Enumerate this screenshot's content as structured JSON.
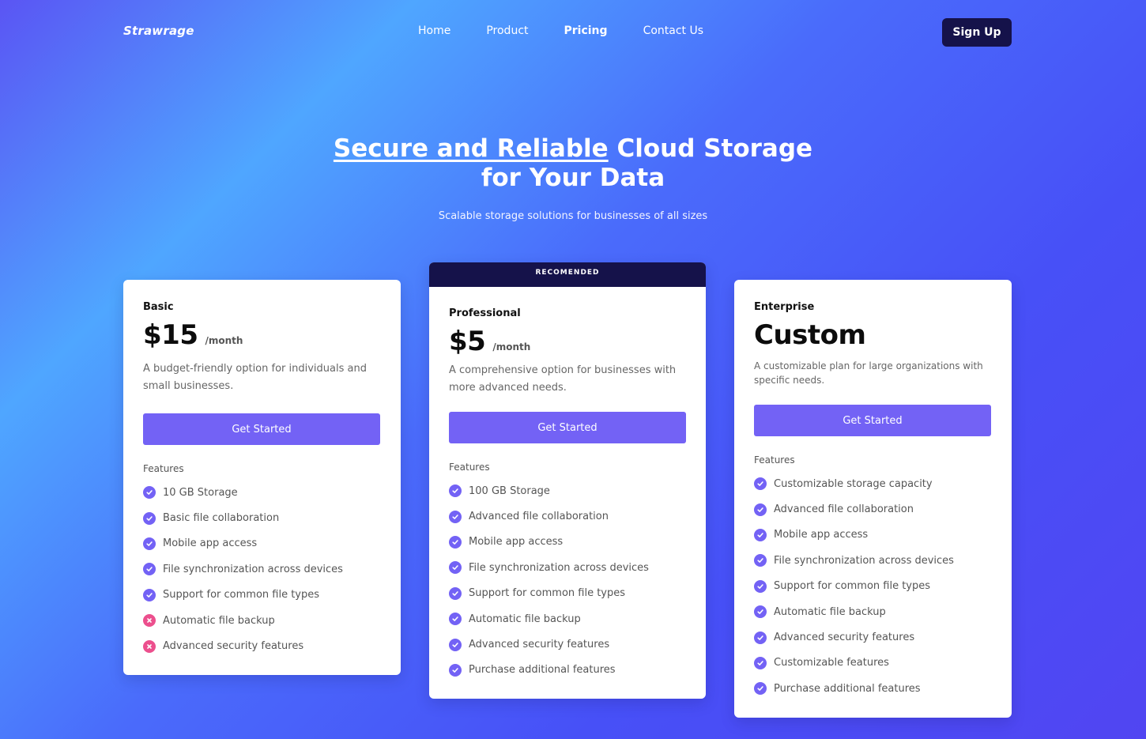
{
  "nav": {
    "brand": "Strawrage",
    "links": [
      {
        "label": "Home",
        "active": false
      },
      {
        "label": "Product",
        "active": false
      },
      {
        "label": "Pricing",
        "active": true
      },
      {
        "label": "Contact Us",
        "active": false
      }
    ],
    "signup_label": "Sign Up"
  },
  "hero": {
    "title_highlight": "Secure and Reliable",
    "title_rest": " Cloud Storage for Your Data",
    "subtitle": "Scalable storage solutions for businesses of all sizes"
  },
  "colors": {
    "accent": "#7362f5",
    "dark": "#15124a",
    "cross": "#ec4f8d",
    "gradient_light": "#4fa6ff",
    "gradient_deep": "#4750f7"
  },
  "plans": {
    "basic": {
      "name": "Basic",
      "price": "$15",
      "period": "/month",
      "description": "A budget-friendly option for individuals and small businesses.",
      "cta": "Get Started",
      "features_title": "Features",
      "features": [
        {
          "label": "10 GB Storage",
          "included": true,
          "icon": "check-icon"
        },
        {
          "label": "Basic file collaboration",
          "included": true,
          "icon": "check-icon"
        },
        {
          "label": "Mobile app access",
          "included": true,
          "icon": "check-icon"
        },
        {
          "label": "File synchronization across devices",
          "included": true,
          "icon": "check-icon"
        },
        {
          "label": "Support for common file types",
          "included": true,
          "icon": "check-icon"
        },
        {
          "label": "Automatic file backup",
          "included": false,
          "icon": "cross-icon"
        },
        {
          "label": "Advanced security features",
          "included": false,
          "icon": "cross-icon"
        }
      ]
    },
    "professional": {
      "badge": "RECOMENDED",
      "name": "Professional",
      "price": "$5",
      "period": "/month",
      "description": "A comprehensive option for businesses with more advanced needs.",
      "cta": "Get Started",
      "features_title": "Features",
      "features": [
        {
          "label": "100 GB Storage",
          "included": true,
          "icon": "check-icon"
        },
        {
          "label": "Advanced file collaboration",
          "included": true,
          "icon": "check-icon"
        },
        {
          "label": "Mobile app access",
          "included": true,
          "icon": "check-icon"
        },
        {
          "label": "File synchronization across devices",
          "included": true,
          "icon": "check-icon"
        },
        {
          "label": "Support for common file types",
          "included": true,
          "icon": "check-icon"
        },
        {
          "label": "Automatic file backup",
          "included": true,
          "icon": "check-icon"
        },
        {
          "label": "Advanced security features",
          "included": true,
          "icon": "check-icon"
        },
        {
          "label": "Purchase additional features",
          "included": true,
          "icon": "check-icon"
        }
      ]
    },
    "enterprise": {
      "name": "Enterprise",
      "price": "Custom",
      "description": "A customizable plan for large organizations with specific needs.",
      "cta": "Get Started",
      "features_title": "Features",
      "features": [
        {
          "label": "Customizable storage capacity",
          "included": true,
          "icon": "check-icon"
        },
        {
          "label": "Advanced file collaboration",
          "included": true,
          "icon": "check-icon"
        },
        {
          "label": "Mobile app access",
          "included": true,
          "icon": "check-icon"
        },
        {
          "label": "File synchronization across devices",
          "included": true,
          "icon": "check-icon"
        },
        {
          "label": "Support for common file types",
          "included": true,
          "icon": "check-icon"
        },
        {
          "label": "Automatic file backup",
          "included": true,
          "icon": "check-icon"
        },
        {
          "label": "Advanced security features",
          "included": true,
          "icon": "check-icon"
        },
        {
          "label": "Customizable features",
          "included": true,
          "icon": "check-icon"
        },
        {
          "label": "Purchase additional features",
          "included": true,
          "icon": "check-icon"
        }
      ]
    }
  }
}
